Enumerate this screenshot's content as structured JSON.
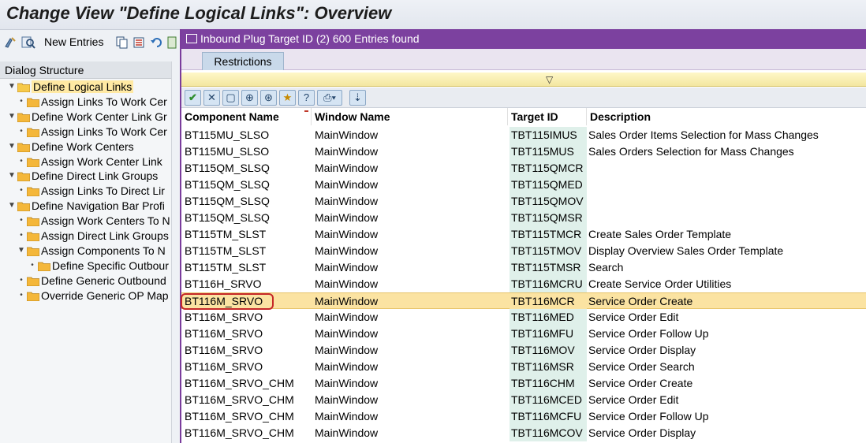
{
  "window": {
    "title": "Change View \"Define Logical Links\": Overview"
  },
  "toolbar": {
    "new_entries_label": "New Entries"
  },
  "dialog_structure": {
    "header": "Dialog Structure",
    "items": [
      {
        "label": "Define Logical Links",
        "level": 0,
        "selected": true
      },
      {
        "label": "Assign Links To Work Cer",
        "level": 1
      },
      {
        "label": "Define Work Center Link Gr",
        "level": 0
      },
      {
        "label": "Assign Links To Work Cer",
        "level": 1
      },
      {
        "label": "Define Work Centers",
        "level": 0
      },
      {
        "label": "Assign Work Center Link",
        "level": 1
      },
      {
        "label": "Define Direct Link Groups",
        "level": 0
      },
      {
        "label": "Assign Links To Direct Lir",
        "level": 1
      },
      {
        "label": "Define Navigation Bar Profi",
        "level": 0
      },
      {
        "label": "Assign Work Centers To N",
        "level": 1
      },
      {
        "label": "Assign Direct Link Groups",
        "level": 1
      },
      {
        "label": "Assign Components To N",
        "level": 1
      },
      {
        "label": "Define Specific Outbour",
        "level": 2
      },
      {
        "label": "Define Generic Outbound",
        "level": 1
      },
      {
        "label": "Override Generic OP Map",
        "level": 1
      }
    ]
  },
  "popup": {
    "title": "Inbound Plug Target ID (2)  600 Entries found",
    "tab_label": "Restrictions",
    "columns": [
      "Component Name",
      "Window Name",
      "Target ID",
      "Description"
    ],
    "rows": [
      {
        "component": "BT115MU_SLSO",
        "window": "MainWindow",
        "target": "TBT115IMUS",
        "description": "Sales Order Items Selection for Mass Changes"
      },
      {
        "component": "BT115MU_SLSO",
        "window": "MainWindow",
        "target": "TBT115MUS",
        "description": "Sales Orders Selection for Mass Changes"
      },
      {
        "component": "BT115QM_SLSQ",
        "window": "MainWindow",
        "target": "TBT115QMCR",
        "description": ""
      },
      {
        "component": "BT115QM_SLSQ",
        "window": "MainWindow",
        "target": "TBT115QMED",
        "description": ""
      },
      {
        "component": "BT115QM_SLSQ",
        "window": "MainWindow",
        "target": "TBT115QMOV",
        "description": ""
      },
      {
        "component": "BT115QM_SLSQ",
        "window": "MainWindow",
        "target": "TBT115QMSR",
        "description": ""
      },
      {
        "component": "BT115TM_SLST",
        "window": "MainWindow",
        "target": "TBT115TMCR",
        "description": "Create Sales Order Template"
      },
      {
        "component": "BT115TM_SLST",
        "window": "MainWindow",
        "target": "TBT115TMOV",
        "description": "Display Overview Sales Order Template"
      },
      {
        "component": "BT115TM_SLST",
        "window": "MainWindow",
        "target": "TBT115TMSR",
        "description": "Search"
      },
      {
        "component": "BT116H_SRVO",
        "window": "MainWindow",
        "target": "TBT116MCRU",
        "description": "Create Service Order Utilities"
      },
      {
        "component": "BT116M_SRVO",
        "window": "MainWindow",
        "target": "TBT116MCR",
        "description": "Service Order Create",
        "selected": true
      },
      {
        "component": "BT116M_SRVO",
        "window": "MainWindow",
        "target": "TBT116MED",
        "description": "Service Order Edit"
      },
      {
        "component": "BT116M_SRVO",
        "window": "MainWindow",
        "target": "TBT116MFU",
        "description": "Service Order Follow Up"
      },
      {
        "component": "BT116M_SRVO",
        "window": "MainWindow",
        "target": "TBT116MOV",
        "description": "Service Order Display"
      },
      {
        "component": "BT116M_SRVO",
        "window": "MainWindow",
        "target": "TBT116MSR",
        "description": "Service Order Search"
      },
      {
        "component": "BT116M_SRVO_CHM",
        "window": "MainWindow",
        "target": "TBT116CHM",
        "description": "Service Order Create"
      },
      {
        "component": "BT116M_SRVO_CHM",
        "window": "MainWindow",
        "target": "TBT116MCED",
        "description": "Service Order Edit"
      },
      {
        "component": "BT116M_SRVO_CHM",
        "window": "MainWindow",
        "target": "TBT116MCFU",
        "description": "Service Order Follow Up"
      },
      {
        "component": "BT116M_SRVO_CHM",
        "window": "MainWindow",
        "target": "TBT116MCOV",
        "description": "Service Order Display"
      }
    ]
  },
  "colors": {
    "popup_title": "#7c419f",
    "selection": "#fbe3a2",
    "target_column": "#dff0ea",
    "highlight_box": "#c62828"
  }
}
